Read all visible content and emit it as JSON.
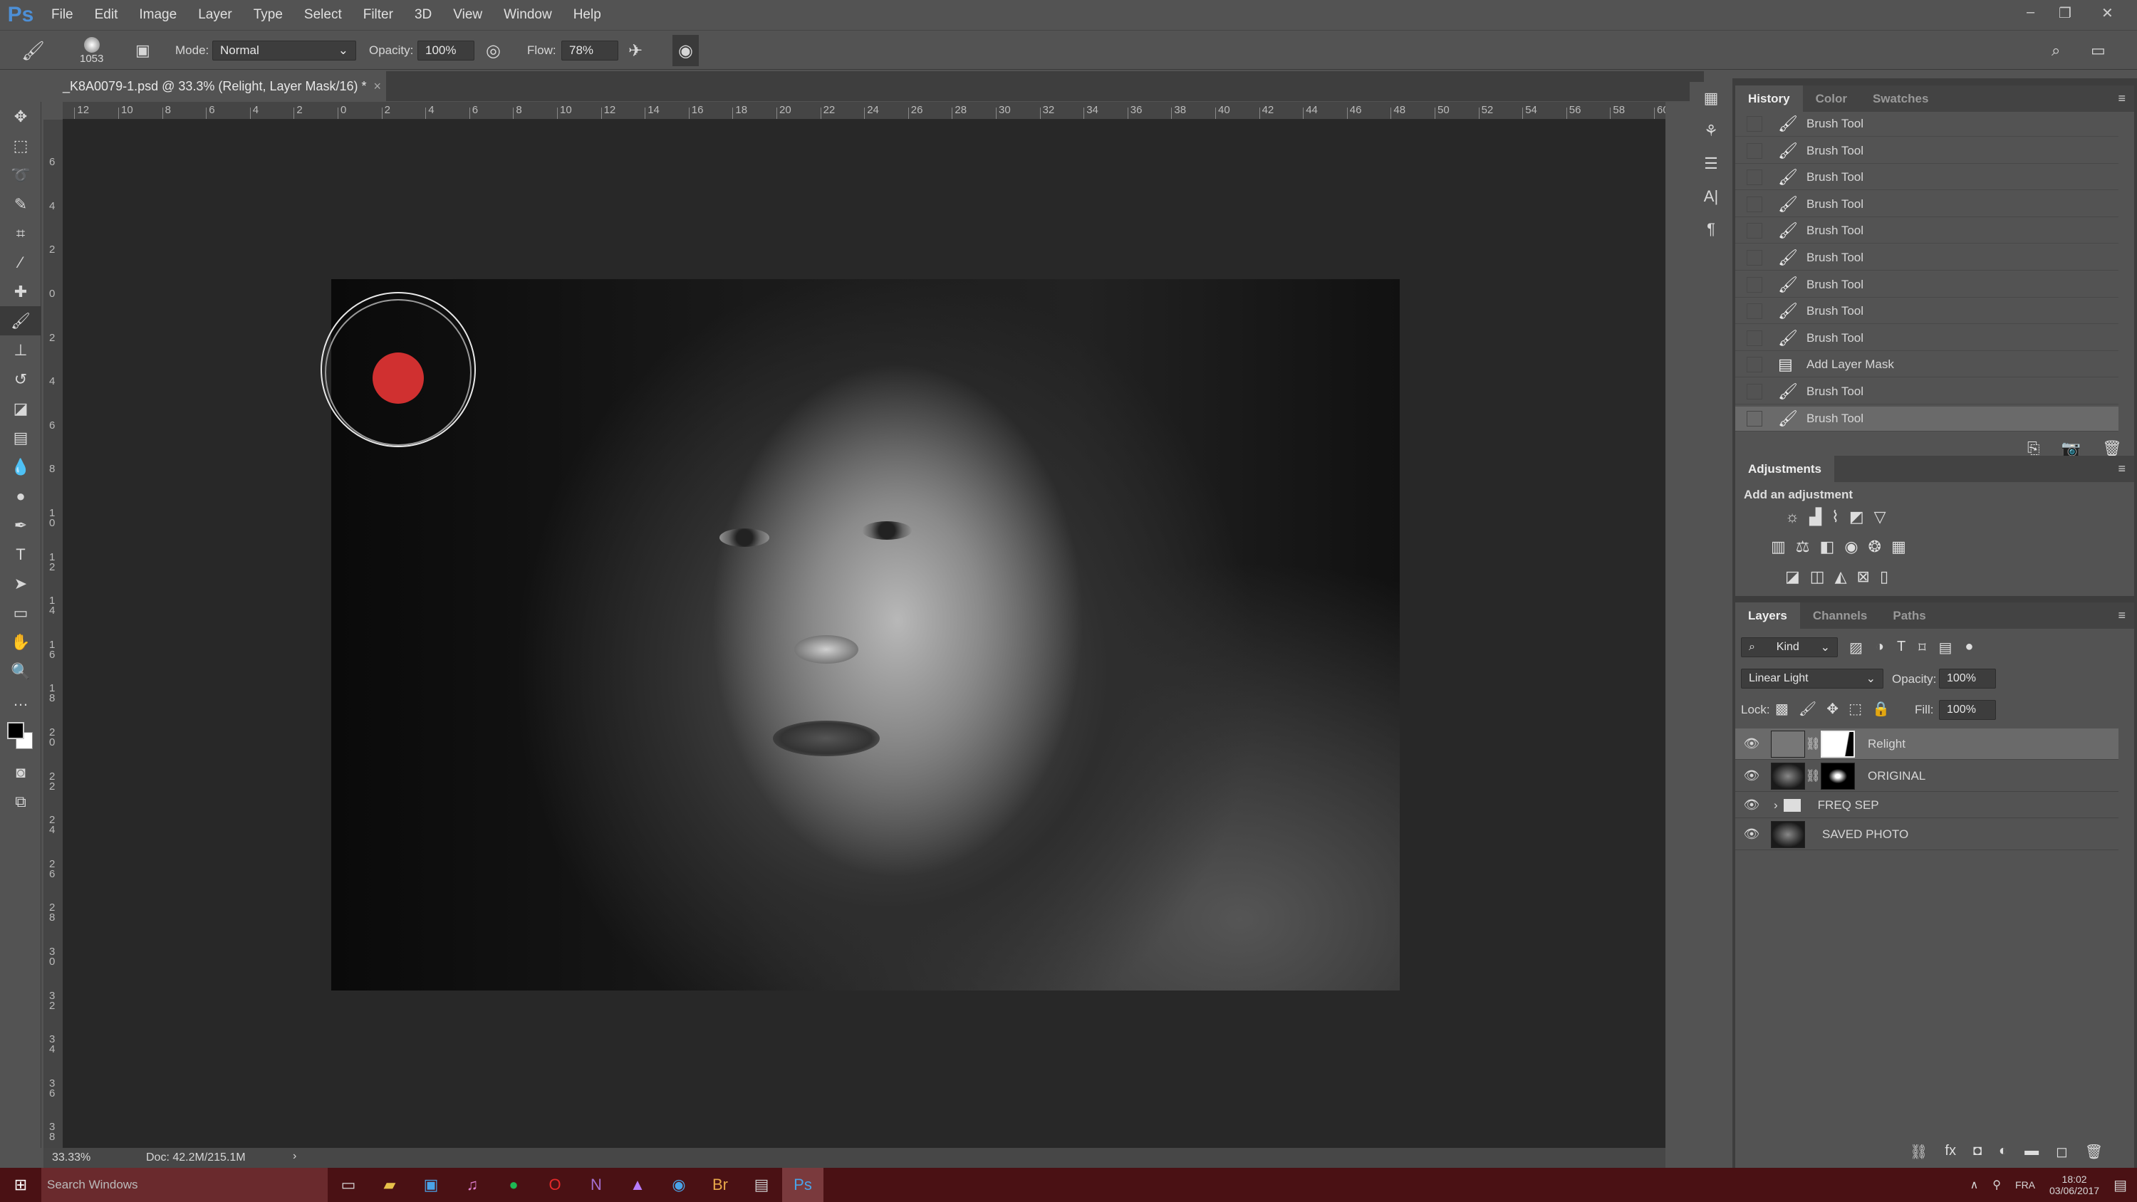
{
  "app": {
    "logo": "Ps",
    "menu": [
      "File",
      "Edit",
      "Image",
      "Layer",
      "Type",
      "Select",
      "Filter",
      "3D",
      "View",
      "Window",
      "Help"
    ],
    "window_controls": [
      "–",
      "❐",
      "✕"
    ]
  },
  "options": {
    "brush_size": "1053",
    "mode_label": "Mode:",
    "mode_value": "Normal",
    "opacity_label": "Opacity:",
    "opacity_value": "100%",
    "flow_label": "Flow:",
    "flow_value": "78%"
  },
  "document": {
    "tab_title": "_K8A0079-1.psd @ 33.3% (Relight, Layer Mask/16) *",
    "close": "×"
  },
  "rulers": {
    "top": [
      "12",
      "10",
      "8",
      "6",
      "4",
      "2",
      "0",
      "2",
      "4",
      "6",
      "8",
      "10",
      "12",
      "14",
      "16",
      "18",
      "20",
      "22",
      "24",
      "26",
      "28",
      "30",
      "32",
      "34",
      "36",
      "38",
      "40",
      "42",
      "44",
      "46",
      "48",
      "50",
      "52",
      "54",
      "56",
      "58",
      "60"
    ],
    "left": [
      "6",
      "4",
      "2",
      "0",
      "2",
      "4",
      "6",
      "8",
      "10",
      "12",
      "14",
      "16",
      "18",
      "20",
      "22",
      "24",
      "26",
      "28",
      "30",
      "32",
      "34",
      "36",
      "38"
    ]
  },
  "brush_cursor": {
    "color": "#d03030"
  },
  "status": {
    "zoom": "33.33%",
    "doc": "Doc: 42.2M/215.1M",
    "arrow": "›"
  },
  "history": {
    "tabs": [
      "History",
      "Color",
      "Swatches"
    ],
    "active_tab": "History",
    "items": [
      {
        "label": "Brush Tool",
        "icon": "brush"
      },
      {
        "label": "Brush Tool",
        "icon": "brush"
      },
      {
        "label": "Brush Tool",
        "icon": "brush"
      },
      {
        "label": "Brush Tool",
        "icon": "brush"
      },
      {
        "label": "Brush Tool",
        "icon": "brush"
      },
      {
        "label": "Brush Tool",
        "icon": "brush"
      },
      {
        "label": "Brush Tool",
        "icon": "brush"
      },
      {
        "label": "Brush Tool",
        "icon": "brush"
      },
      {
        "label": "Brush Tool",
        "icon": "brush"
      },
      {
        "label": "Add Layer Mask",
        "icon": "document"
      },
      {
        "label": "Brush Tool",
        "icon": "brush"
      },
      {
        "label": "Brush Tool",
        "icon": "brush",
        "selected": true
      }
    ]
  },
  "adjustments": {
    "title": "Adjustments",
    "subtitle": "Add an adjustment"
  },
  "layers": {
    "tabs": [
      "Layers",
      "Channels",
      "Paths"
    ],
    "active_tab": "Layers",
    "filter": "Kind",
    "blend_mode": "Linear Light",
    "opacity_label": "Opacity:",
    "opacity": "100%",
    "lock_label": "Lock:",
    "fill_label": "Fill:",
    "fill": "100%",
    "items": [
      {
        "name": "Relight",
        "selected": true,
        "visible": true,
        "mask": true
      },
      {
        "name": "ORIGINAL",
        "visible": true,
        "mask": true
      },
      {
        "name": "FREQ SEP",
        "visible": true,
        "group": true
      },
      {
        "name": "SAVED PHOTO",
        "visible": true,
        "smart": true
      }
    ]
  },
  "taskbar": {
    "search_placeholder": "Search Windows",
    "time": "18:02",
    "date": "03/06/2017",
    "lang": "FRA",
    "accent": "#4a1114"
  }
}
